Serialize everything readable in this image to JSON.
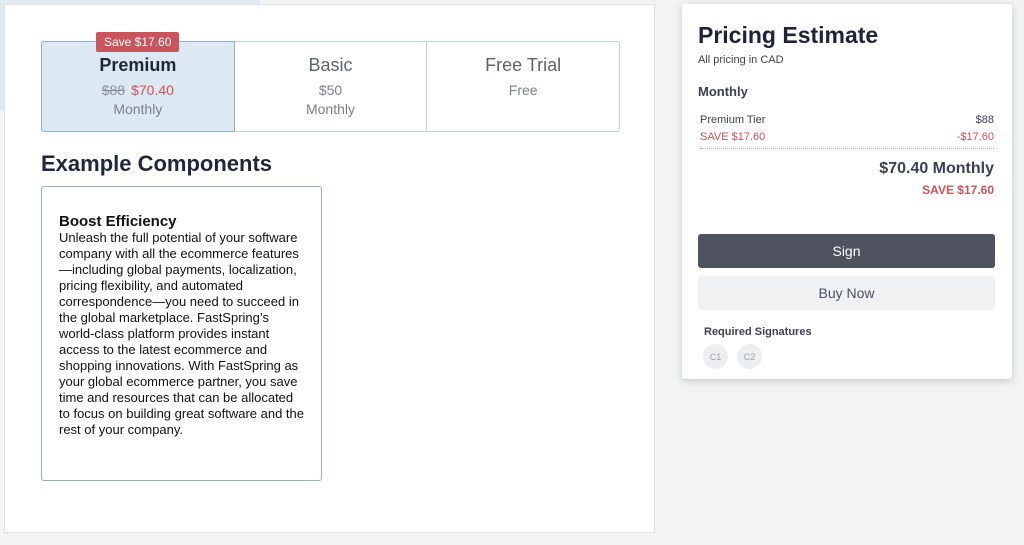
{
  "tiers": [
    {
      "name": "Premium",
      "original_price": "$88",
      "price": "$70.40",
      "period": "Monthly",
      "badge": "Save $17.60",
      "selected": true
    },
    {
      "name": "Basic",
      "price": "$50",
      "period": "Monthly"
    },
    {
      "name": "Free Trial",
      "price": "Free"
    }
  ],
  "section": {
    "title": "Example Components"
  },
  "feature": {
    "title": "Boost Efficiency",
    "body": "Unleash the full potential of your software company with all the ecommerce features—including global payments, localization, pricing flexibility, and automated correspondence—you need to succeed in the global marketplace. FastSpring’s world-class platform provides instant access to the latest ecommerce and shopping innovations. With FastSpring as your global ecommerce partner, you save time and resources that can be allocated to focus on building great software and the rest of your company."
  },
  "estimate": {
    "title": "Pricing Estimate",
    "subtitle": "All pricing in CAD",
    "period": "Monthly",
    "line_item_label": "Premium Tier",
    "line_item_value": "$88",
    "save_label": "SAVE $17.60",
    "save_value": "-$17.60",
    "total": "$70.40 Monthly",
    "total_save": "SAVE $17.60",
    "sign_label": "Sign",
    "buy_label": "Buy Now",
    "required_label": "Required Signatures",
    "signatures": [
      "C1",
      "C2"
    ]
  },
  "colors": {
    "accent_red": "#c9545b",
    "selected_bg": "#dce9f3",
    "sign_button": "#4f525f"
  }
}
